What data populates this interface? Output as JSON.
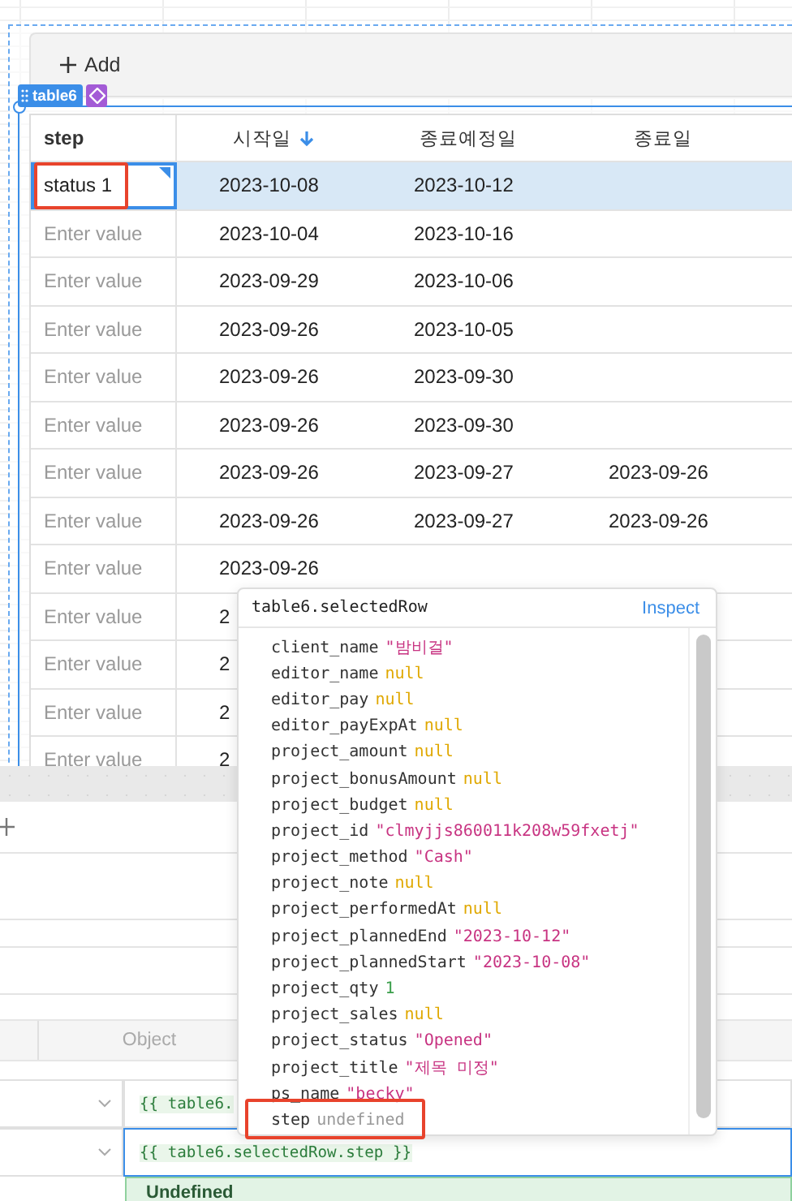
{
  "add_bar": {
    "label": "Add"
  },
  "component_tag": {
    "label": "table6"
  },
  "table": {
    "columns": [
      {
        "label": "step",
        "sorted": false
      },
      {
        "label": "시작일",
        "sorted": true
      },
      {
        "label": "종료예정일",
        "sorted": false
      },
      {
        "label": "종료일",
        "sorted": false
      }
    ],
    "rows": [
      {
        "selected": true,
        "focused": true,
        "highlighted": true,
        "cells": [
          {
            "value": "status 1"
          },
          {
            "value": "2023-10-08"
          },
          {
            "value": "2023-10-12"
          }
        ]
      },
      {
        "selected": false,
        "focused": false,
        "highlighted": false,
        "cells": [
          {
            "placeholder": "Enter value"
          },
          {
            "value": "2023-10-04"
          },
          {
            "value": "2023-10-16"
          }
        ]
      },
      {
        "selected": false,
        "focused": false,
        "highlighted": false,
        "cells": [
          {
            "placeholder": "Enter value"
          },
          {
            "value": "2023-09-29"
          },
          {
            "value": "2023-10-06"
          }
        ]
      },
      {
        "selected": false,
        "focused": false,
        "highlighted": false,
        "cells": [
          {
            "placeholder": "Enter value"
          },
          {
            "value": "2023-09-26"
          },
          {
            "value": "2023-10-05"
          }
        ]
      },
      {
        "selected": false,
        "focused": false,
        "highlighted": false,
        "cells": [
          {
            "placeholder": "Enter value"
          },
          {
            "value": "2023-09-26"
          },
          {
            "value": "2023-09-30"
          }
        ]
      },
      {
        "selected": false,
        "focused": false,
        "highlighted": false,
        "cells": [
          {
            "placeholder": "Enter value"
          },
          {
            "value": "2023-09-26"
          },
          {
            "value": "2023-09-30"
          }
        ]
      },
      {
        "selected": false,
        "focused": false,
        "highlighted": false,
        "cells": [
          {
            "placeholder": "Enter value"
          },
          {
            "value": "2023-09-26"
          },
          {
            "value": "2023-09-27"
          },
          {
            "value": "2023-09-26"
          }
        ]
      },
      {
        "selected": false,
        "focused": false,
        "highlighted": false,
        "cells": [
          {
            "placeholder": "Enter value"
          },
          {
            "value": "2023-09-26"
          },
          {
            "value": "2023-09-27"
          },
          {
            "value": "2023-09-26"
          }
        ]
      },
      {
        "selected": false,
        "focused": false,
        "highlighted": false,
        "cells": [
          {
            "placeholder": "Enter value"
          },
          {
            "value": "2023-09-26"
          }
        ]
      },
      {
        "selected": false,
        "focused": false,
        "highlighted": false,
        "cells": [
          {
            "placeholder": "Enter value"
          },
          {
            "value": "2"
          }
        ]
      },
      {
        "selected": false,
        "focused": false,
        "highlighted": false,
        "cells": [
          {
            "placeholder": "Enter value"
          },
          {
            "value": "2"
          }
        ]
      },
      {
        "selected": false,
        "focused": false,
        "highlighted": false,
        "cells": [
          {
            "placeholder": "Enter value"
          },
          {
            "value": "2"
          }
        ]
      },
      {
        "selected": false,
        "focused": false,
        "highlighted": false,
        "cells": [
          {
            "placeholder": "Enter value"
          },
          {
            "value": "2"
          }
        ]
      }
    ]
  },
  "query_panel": {
    "column_header": "Object",
    "code_fields": [
      {
        "code": "{{ table6.",
        "focused": false
      },
      {
        "code": "{{ table6.selectedRow.step }}",
        "focused": true
      }
    ],
    "result": "Undefined"
  },
  "inspector": {
    "title": "table6.selectedRow",
    "action": "Inspect",
    "entries": [
      {
        "key": "client_name",
        "value": "\"밤비걸\"",
        "kind": "string",
        "highlighted": false
      },
      {
        "key": "editor_name",
        "value": "null",
        "kind": "null",
        "highlighted": false
      },
      {
        "key": "editor_pay",
        "value": "null",
        "kind": "null",
        "highlighted": false
      },
      {
        "key": "editor_payExpAt",
        "value": "null",
        "kind": "null",
        "highlighted": false
      },
      {
        "key": "project_amount",
        "value": "null",
        "kind": "null",
        "highlighted": false
      },
      {
        "key": "project_bonusAmount",
        "value": "null",
        "kind": "null",
        "highlighted": false
      },
      {
        "key": "project_budget",
        "value": "null",
        "kind": "null",
        "highlighted": false
      },
      {
        "key": "project_id",
        "value": "\"clmyjjs860011k208w59fxetj\"",
        "kind": "string",
        "highlighted": false
      },
      {
        "key": "project_method",
        "value": "\"Cash\"",
        "kind": "string",
        "highlighted": false
      },
      {
        "key": "project_note",
        "value": "null",
        "kind": "null",
        "highlighted": false
      },
      {
        "key": "project_performedAt",
        "value": "null",
        "kind": "null",
        "highlighted": false
      },
      {
        "key": "project_plannedEnd",
        "value": "\"2023-10-12\"",
        "kind": "string",
        "highlighted": false
      },
      {
        "key": "project_plannedStart",
        "value": "\"2023-10-08\"",
        "kind": "string",
        "highlighted": false
      },
      {
        "key": "project_qty",
        "value": "1",
        "kind": "number",
        "highlighted": false
      },
      {
        "key": "project_sales",
        "value": "null",
        "kind": "null",
        "highlighted": false
      },
      {
        "key": "project_status",
        "value": "\"Opened\"",
        "kind": "string",
        "highlighted": false
      },
      {
        "key": "project_title",
        "value": "\"제목 미정\"",
        "kind": "string",
        "highlighted": false
      },
      {
        "key": "ps_name",
        "value": "\"becky\"",
        "kind": "string",
        "highlighted": false
      },
      {
        "key": "step",
        "value": "undefined",
        "kind": "undefined",
        "highlighted": true
      }
    ]
  }
}
